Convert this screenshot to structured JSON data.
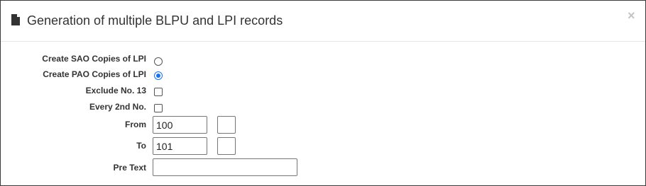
{
  "dialog": {
    "title": "Generation of multiple BLPU and LPI records",
    "icon": "file-icon",
    "close_label": "×"
  },
  "form": {
    "sao_label": "Create SAO Copies of LPI",
    "sao_checked": false,
    "pao_label": "Create PAO Copies of LPI",
    "pao_checked": true,
    "exclude13_label": "Exclude No. 13",
    "exclude13_checked": false,
    "every2nd_label": "Every 2nd No.",
    "every2nd_checked": false,
    "from_label": "From",
    "from_value": "100",
    "from_suffix_value": "",
    "to_label": "To",
    "to_value": "101",
    "to_suffix_value": "",
    "pretext_label": "Pre Text",
    "pretext_value": ""
  },
  "colors": {
    "accent": "#1a73e8",
    "text": "#333333",
    "border": "#3a3a3a"
  }
}
